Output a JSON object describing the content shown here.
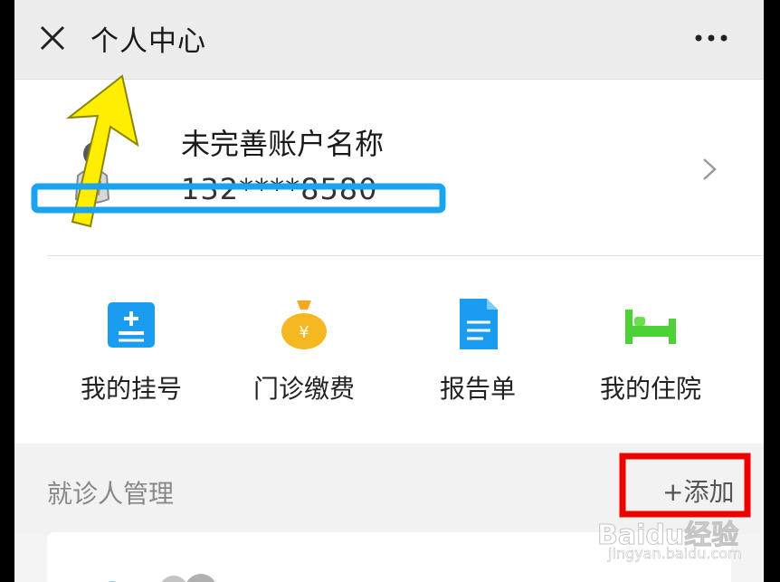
{
  "header": {
    "title": "个人中心",
    "close_icon": "close-icon",
    "more_icon": "more-horizontal-icon"
  },
  "profile": {
    "account_name": "未完善账户名称",
    "phone": "132****8580",
    "avatar_icon": "avatar-icon",
    "chevron_icon": "chevron-right-icon"
  },
  "shortcuts": [
    {
      "label": "我的挂号",
      "icon": "registration-icon",
      "color": "#1a9cf0"
    },
    {
      "label": "门诊缴费",
      "icon": "money-bag-icon",
      "color": "#f5b820"
    },
    {
      "label": "报告单",
      "icon": "report-document-icon",
      "color": "#1a9cf0"
    },
    {
      "label": "我的住院",
      "icon": "hospital-bed-icon",
      "color": "#4cd137"
    }
  ],
  "patients": {
    "section_title": "就诊人管理",
    "add_label": "+添加"
  },
  "watermark": {
    "logo": "Baidu经验",
    "url": "jingyan.baidu.com"
  },
  "annotations": {
    "arrow_color": "#ffee00",
    "highlight_box_color": "#1aa3ee",
    "emphasis_box_color": "#ee0000"
  }
}
